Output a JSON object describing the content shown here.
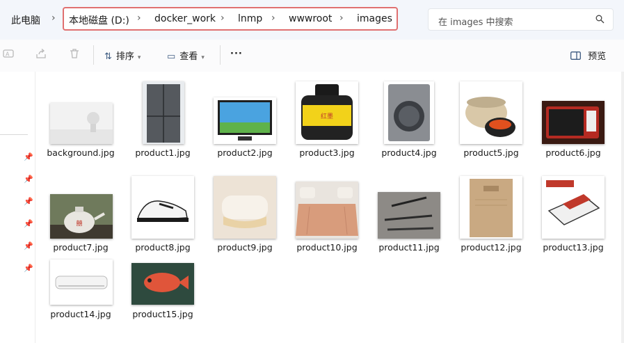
{
  "breadcrumb": {
    "root": "此电脑",
    "items": [
      "本地磁盘 (D:)",
      "docker_work",
      "lnmp",
      "wwwroot",
      "images"
    ],
    "separator": "›"
  },
  "search": {
    "placeholder": "在 images 中搜索"
  },
  "toolbar": {
    "sort_label": "排序",
    "view_label": "查看",
    "more_label": "···",
    "preview_label": "预览"
  },
  "files": [
    {
      "name": "background.jpg",
      "thumb": "background"
    },
    {
      "name": "product1.jpg",
      "thumb": "fridge"
    },
    {
      "name": "product2.jpg",
      "thumb": "tv"
    },
    {
      "name": "product3.jpg",
      "thumb": "ink-bottle"
    },
    {
      "name": "product4.jpg",
      "thumb": "washer"
    },
    {
      "name": "product5.jpg",
      "thumb": "rice-cooker"
    },
    {
      "name": "product6.jpg",
      "thumb": "microwave"
    },
    {
      "name": "product7.jpg",
      "thumb": "teapot"
    },
    {
      "name": "product8.jpg",
      "thumb": "sneaker"
    },
    {
      "name": "product9.jpg",
      "thumb": "pillow"
    },
    {
      "name": "product10.jpg",
      "thumb": "bed"
    },
    {
      "name": "product11.jpg",
      "thumb": "pens"
    },
    {
      "name": "product12.jpg",
      "thumb": "notebook"
    },
    {
      "name": "product13.jpg",
      "thumb": "eraser"
    },
    {
      "name": "product14.jpg",
      "thumb": "air-conditioner"
    },
    {
      "name": "product15.jpg",
      "thumb": "fish"
    }
  ],
  "colors": {
    "highlight_border": "#e07070",
    "address_bg": "#f3f6fb",
    "accent": "#3d5a80"
  }
}
